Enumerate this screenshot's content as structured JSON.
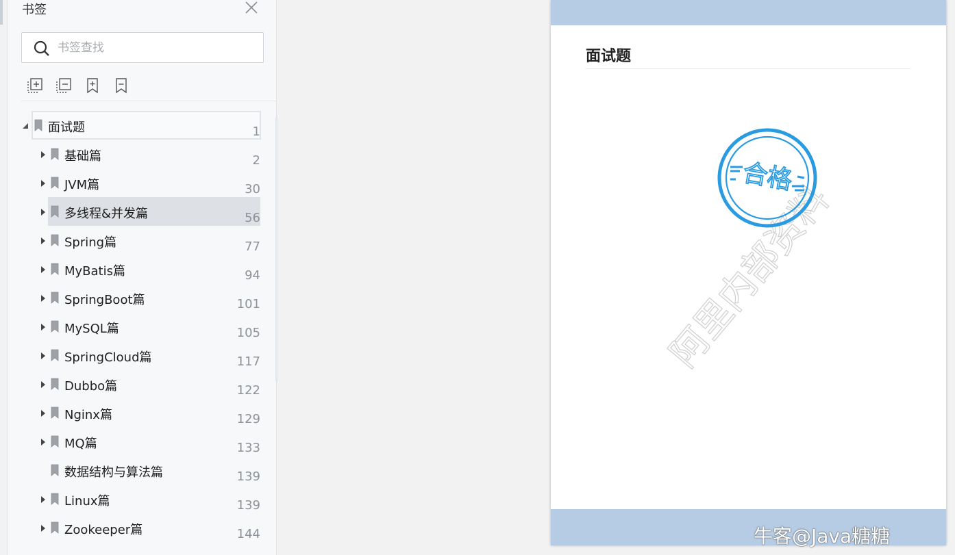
{
  "sidebar": {
    "title": "书签",
    "search_placeholder": "书签查找",
    "tools": [
      {
        "icon": "expand-all-icon"
      },
      {
        "icon": "collapse-all-icon"
      },
      {
        "icon": "add-bookmark-icon"
      },
      {
        "icon": "bookmark-icon"
      }
    ],
    "items": [
      {
        "label": "面试题",
        "page": "1",
        "level": 0,
        "expanded": true,
        "has_children": true,
        "focused": true
      },
      {
        "label": "基础篇",
        "page": "2",
        "level": 1,
        "has_children": true
      },
      {
        "label": "JVM篇",
        "page": "30",
        "level": 1,
        "has_children": true
      },
      {
        "label": "多线程&并发篇",
        "page": "56",
        "level": 1,
        "has_children": true,
        "selected": true
      },
      {
        "label": "Spring篇",
        "page": "77",
        "level": 1,
        "has_children": true
      },
      {
        "label": "MyBatis篇",
        "page": "94",
        "level": 1,
        "has_children": true
      },
      {
        "label": "SpringBoot篇",
        "page": "101",
        "level": 1,
        "has_children": true
      },
      {
        "label": "MySQL篇",
        "page": "105",
        "level": 1,
        "has_children": true
      },
      {
        "label": "SpringCloud篇",
        "page": "117",
        "level": 1,
        "has_children": true
      },
      {
        "label": "Dubbo篇",
        "page": "122",
        "level": 1,
        "has_children": true
      },
      {
        "label": "Nginx篇",
        "page": "129",
        "level": 1,
        "has_children": true
      },
      {
        "label": "MQ篇",
        "page": "133",
        "level": 1,
        "has_children": true
      },
      {
        "label": "数据结构与算法篇",
        "page": "139",
        "level": 1,
        "has_children": false
      },
      {
        "label": "Linux篇",
        "page": "139",
        "level": 1,
        "has_children": true
      },
      {
        "label": "Zookeeper篇",
        "page": "144",
        "level": 1,
        "has_children": true
      }
    ]
  },
  "document": {
    "heading": "面试题",
    "stamp_text": "合格",
    "watermark_text": "阿里内部资料",
    "header_color": "#b6cce4",
    "stamp_color": "#2a9be0"
  },
  "overlay": {
    "credit": "牛客@Java糖糖"
  }
}
